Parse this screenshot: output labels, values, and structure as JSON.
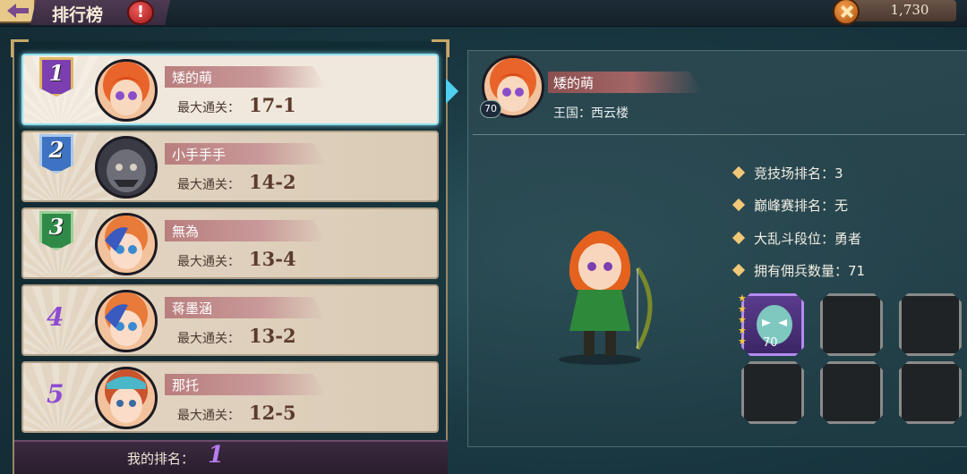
{
  "header": {
    "title": "排行榜",
    "alert_glyph": "!",
    "currency_value": "1,730"
  },
  "rankings": [
    {
      "rank": "1",
      "name": "矮的萌",
      "clear_label": "最大通关：",
      "clear_value": "17-1",
      "badge_color": "#7b3fb0"
    },
    {
      "rank": "2",
      "name": "小手手手",
      "clear_label": "最大通关：",
      "clear_value": "14-2",
      "badge_color": "#3e72c2"
    },
    {
      "rank": "3",
      "name": "無為",
      "clear_label": "最大通关：",
      "clear_value": "13-4",
      "badge_color": "#2f8a48"
    },
    {
      "rank": "4",
      "name": "蒋墨涵",
      "clear_label": "最大通关：",
      "clear_value": "13-2"
    },
    {
      "rank": "5",
      "name": "那托",
      "clear_label": "最大通关：",
      "clear_value": "12-5"
    }
  ],
  "my_rank": {
    "label": "我的排名：",
    "value": "1"
  },
  "detail": {
    "name": "矮的萌",
    "level": "70",
    "kingdom": "王国：西云楼",
    "stats": [
      "竞技场排名：3",
      "巅峰赛排名：无",
      "大乱斗段位：勇者",
      "拥有佣兵数量：71"
    ],
    "mercenary_level": "70"
  },
  "colors": {
    "accent_cyan": "#4fd0f0",
    "rank_purple": "#8d4cd0"
  }
}
